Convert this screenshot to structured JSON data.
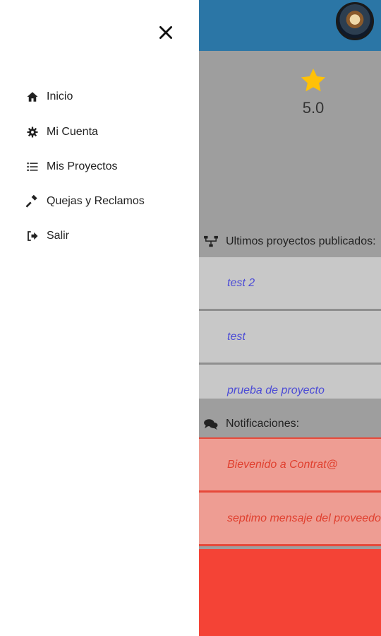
{
  "drawer": {
    "items": [
      {
        "label": "Inicio",
        "icon": "home-icon"
      },
      {
        "label": "Mi Cuenta",
        "icon": "gear-icon"
      },
      {
        "label": "Mis Proyectos",
        "icon": "list-icon"
      },
      {
        "label": "Quejas y Reclamos",
        "icon": "gavel-icon"
      },
      {
        "label": "Salir",
        "icon": "sign-out-icon"
      }
    ]
  },
  "main": {
    "rating": "5.0",
    "projects_header": "Ultimos proyectos publicados:",
    "projects": [
      "test 2",
      "test",
      "prueba de proyecto"
    ],
    "notifications_header": "Notificaciones:",
    "notifications": [
      "Bievenido a Contrat@",
      "septimo mensaje del proveedor"
    ]
  },
  "colors": {
    "topbar": "#2b76a6",
    "gray_panel": "#9e9e9e",
    "project_row": "#c8c8c8",
    "project_text": "#4b4bd6",
    "notif_row": "#ee9d93",
    "notif_text": "#e0402f",
    "red_fill": "#f44336",
    "star": "#ffc107"
  }
}
